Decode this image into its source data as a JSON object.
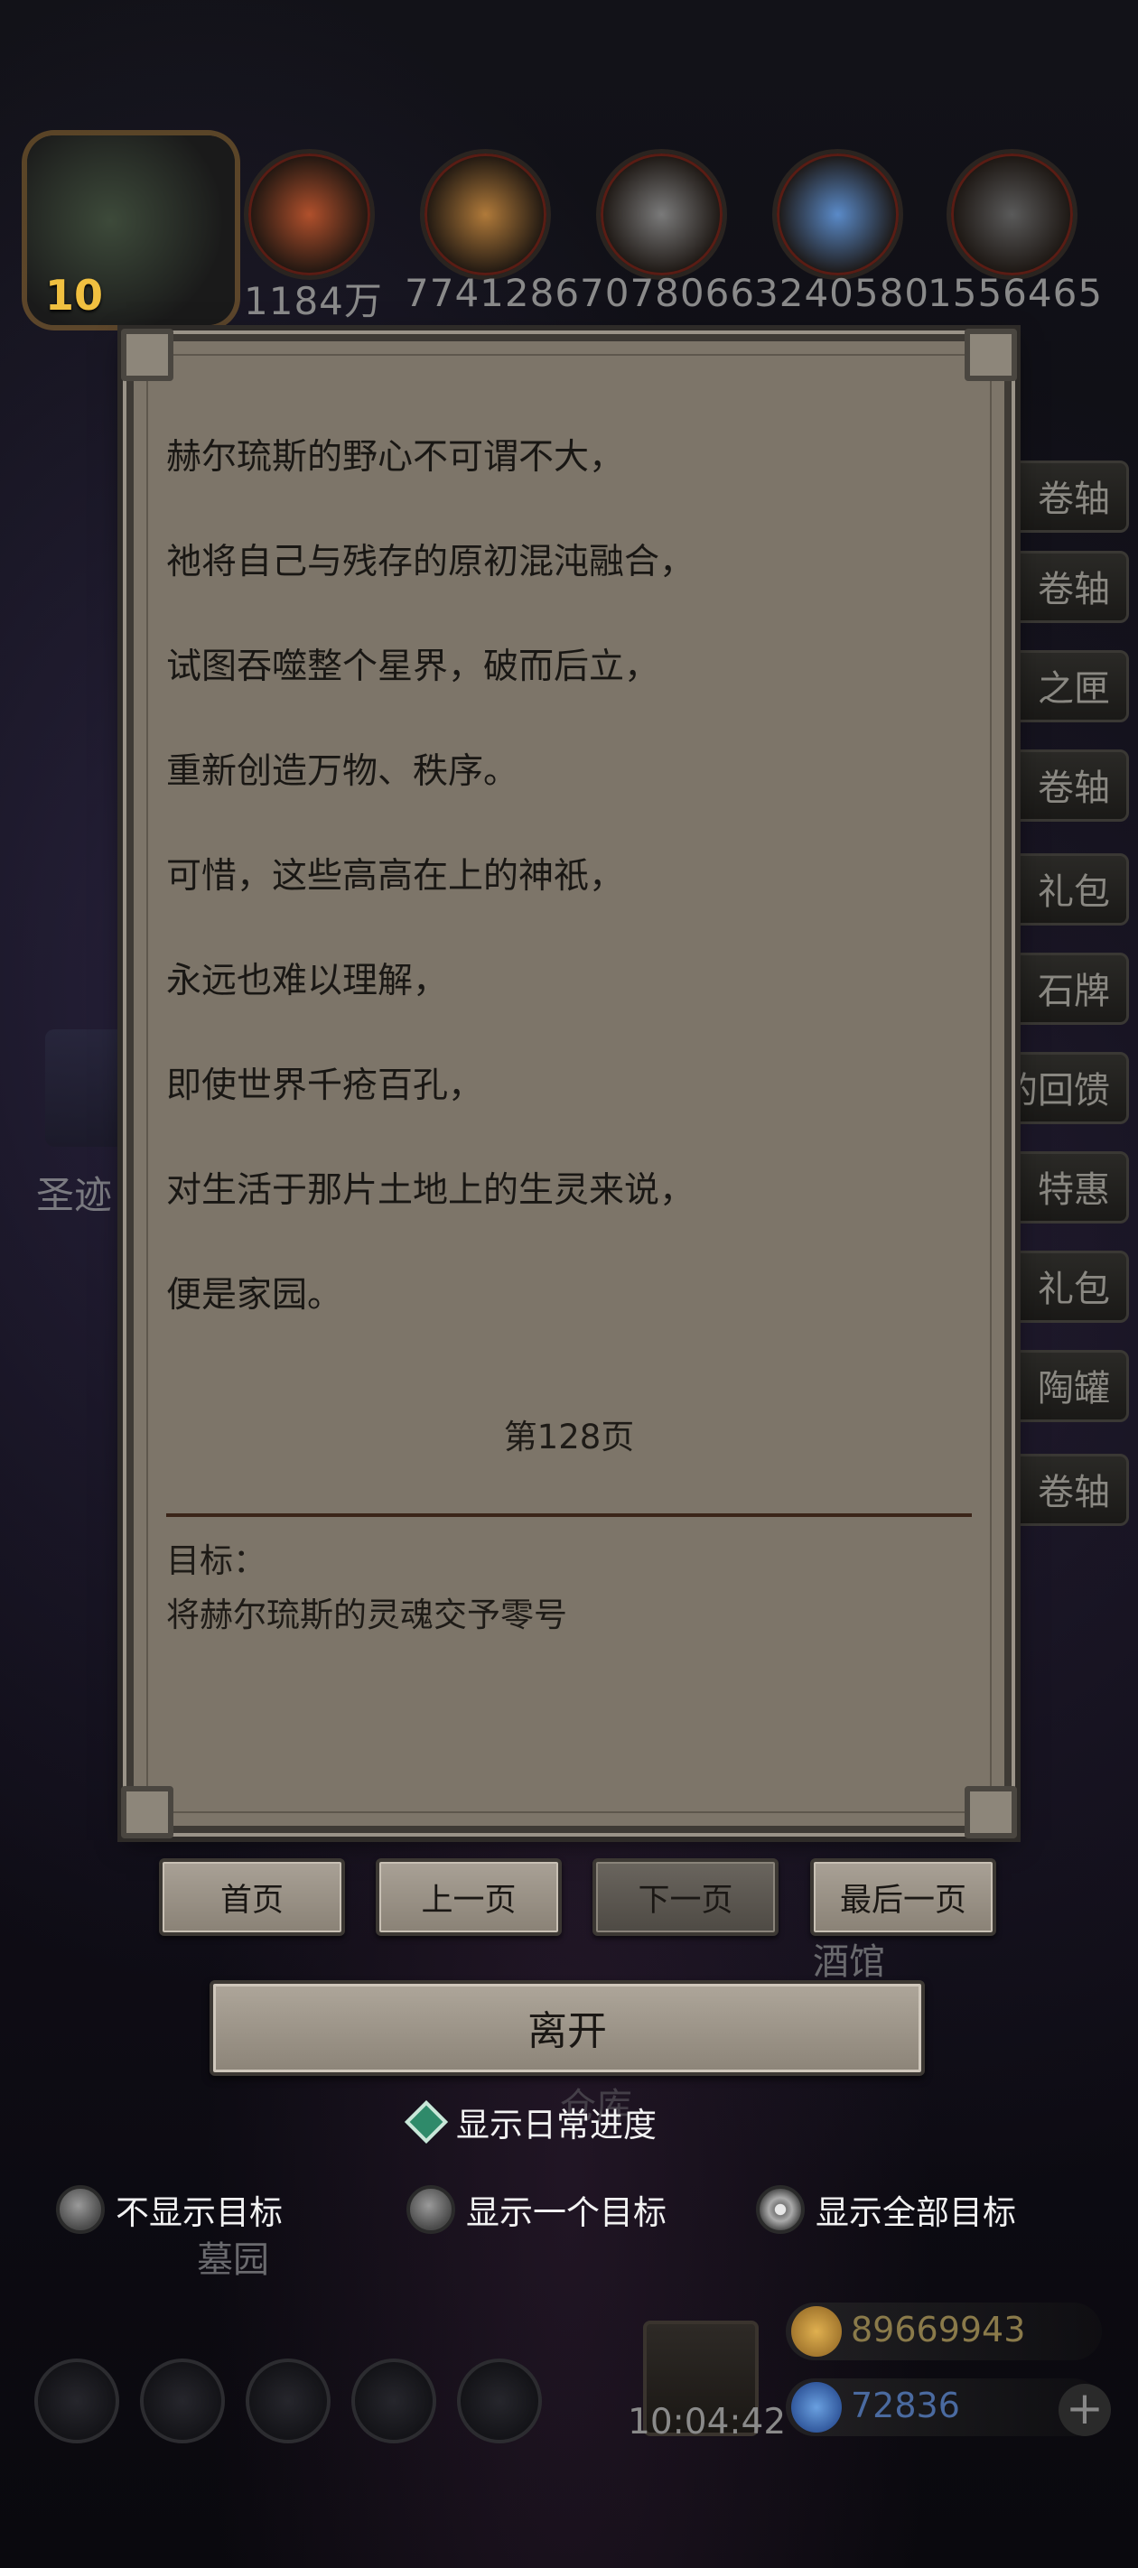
{
  "resources": {
    "player_level": "10",
    "values": [
      "1184万",
      "7741286",
      "7078066",
      "3240580",
      "1556465"
    ],
    "colors": [
      "#b0502c",
      "#b07a3a",
      "#7a7a7a",
      "#5a8ac8",
      "#5a5a5a"
    ]
  },
  "background": {
    "side_buttons": [
      "卷轴",
      "卷轴",
      "之匣",
      "卷轴",
      "礼包",
      "石牌",
      "的回馈",
      "特惠",
      "礼包",
      "陶罐",
      "卷轴"
    ],
    "left_label": "圣迹",
    "tavern_label": "酒馆",
    "warehouse_label": "仓库",
    "graveyard_label": "墓园"
  },
  "book": {
    "story_lines": [
      "赫尔琉斯的野心不可谓不大，",
      "祂将自己与残存的原初混沌融合，",
      "试图吞噬整个星界，破而后立，",
      "重新创造万物、秩序。",
      "可惜，这些高高在上的神祇，",
      "永远也难以理解，",
      "即使世界千疮百孔，",
      "对生活于那片土地上的生灵来说，",
      "便是家园。"
    ],
    "page_label": "第128页",
    "goal_title": "目标：",
    "goal_text": "将赫尔琉斯的灵魂交予零号"
  },
  "nav": {
    "first": "首页",
    "prev": "上一页",
    "next": "下一页",
    "last": "最后一页"
  },
  "leave_label": "离开",
  "daily_progress_label": "显示日常进度",
  "goal_options": {
    "none": "不显示目标",
    "one": "显示一个目标",
    "all": "显示全部目标",
    "selected": "all"
  },
  "bottom": {
    "clock": "10:04:42",
    "gold": "89669943",
    "gems": "72836",
    "gold_color": "#c89a3a",
    "gem_color": "#4a7ac8"
  }
}
